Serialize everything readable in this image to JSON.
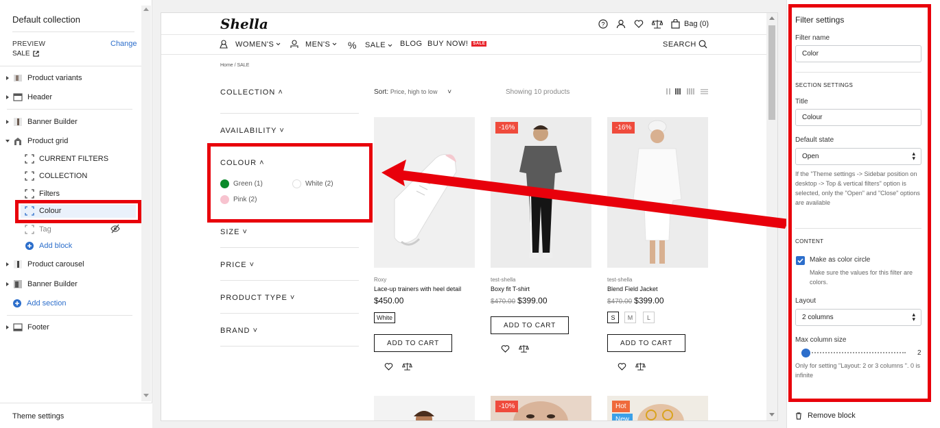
{
  "sidebar": {
    "title": "Default collection",
    "preview_label": "PREVIEW",
    "preview_value": "SALE",
    "change_label": "Change",
    "items": {
      "product_variants": "Product variants",
      "header": "Header",
      "banner_builder_1": "Banner Builder",
      "product_grid": "Product grid",
      "current_filters": "CURRENT FILTERS",
      "collection": "COLLECTION",
      "filters": "Filters",
      "colour": "Colour",
      "tag": "Tag",
      "add_block": "Add block",
      "product_carousel": "Product carousel",
      "banner_builder_2": "Banner Builder",
      "add_section": "Add section",
      "footer": "Footer"
    },
    "theme_settings": "Theme settings"
  },
  "store": {
    "logo": "Shella",
    "bag_label": "Bag (0)",
    "nav": {
      "womens": "WOMEN'S",
      "mens": "MEN'S",
      "sale": "SALE",
      "blog": "BLOG",
      "buy_now": "BUY NOW!",
      "buy_now_badge": "SALE",
      "search": "SEARCH"
    },
    "breadcrumb": "Home  /  SALE",
    "filters": {
      "collection": "COLLECTION",
      "availability": "AVAILABILITY",
      "colour": "COLOUR",
      "size": "SIZE",
      "price": "PRICE",
      "product_type": "PRODUCT TYPE",
      "brand": "BRAND",
      "colours": [
        {
          "label": "Green (1)",
          "color": "#0a8a2a"
        },
        {
          "label": "White (2)",
          "color": "#ffffff"
        },
        {
          "label": "Pink (2)",
          "color": "#f7c3cf"
        }
      ]
    },
    "sort_label": "Sort:",
    "sort_value": "Price, high to low",
    "showing": "Showing 10 products",
    "products": [
      {
        "vendor": "Roxy",
        "name": "Lace-up trainers with heel detail",
        "price": "$450.00",
        "old_price": "",
        "discount": "",
        "option": "White",
        "button": "ADD TO CART"
      },
      {
        "vendor": "test-shella",
        "name": "Boxy fit T-shirt",
        "price": "$399.00",
        "old_price": "$470.00",
        "discount": "-16%",
        "option": "",
        "button": "ADD TO CART"
      },
      {
        "vendor": "test-shella",
        "name": "Blend Field Jacket",
        "price": "$399.00",
        "old_price": "$470.00",
        "discount": "-16%",
        "option": "",
        "sizes": [
          "S",
          "M",
          "L"
        ],
        "button": "ADD TO CART"
      }
    ],
    "row2_badges": {
      "b1": "-10%",
      "hot": "Hot",
      "new": "New"
    }
  },
  "settings": {
    "title": "Filter settings",
    "filter_name_label": "Filter name",
    "filter_name_value": "Color",
    "section_settings": "SECTION SETTINGS",
    "title_label": "Title",
    "title_value": "Colour",
    "default_state_label": "Default state",
    "default_state_value": "Open",
    "default_state_help": "If the \"Theme settings -> Sidebar position on desktop -> Top & vertical filters\" option is selected, only the \"Open\" and \"Close\" options are available",
    "content": "CONTENT",
    "color_circle_label": "Make as color circle",
    "color_circle_help": "Make sure the values for this filter are colors.",
    "color_circle_checked": true,
    "layout_label": "Layout",
    "layout_value": "2 columns",
    "max_column_label": "Max column size",
    "max_column_value": "2",
    "max_column_help": "Only for setting \"Layout: 2 or 3 columns \". 0 is infinite",
    "remove_block": "Remove block",
    "accent_color": "#e8000b",
    "link_color": "#2c6ecb"
  }
}
